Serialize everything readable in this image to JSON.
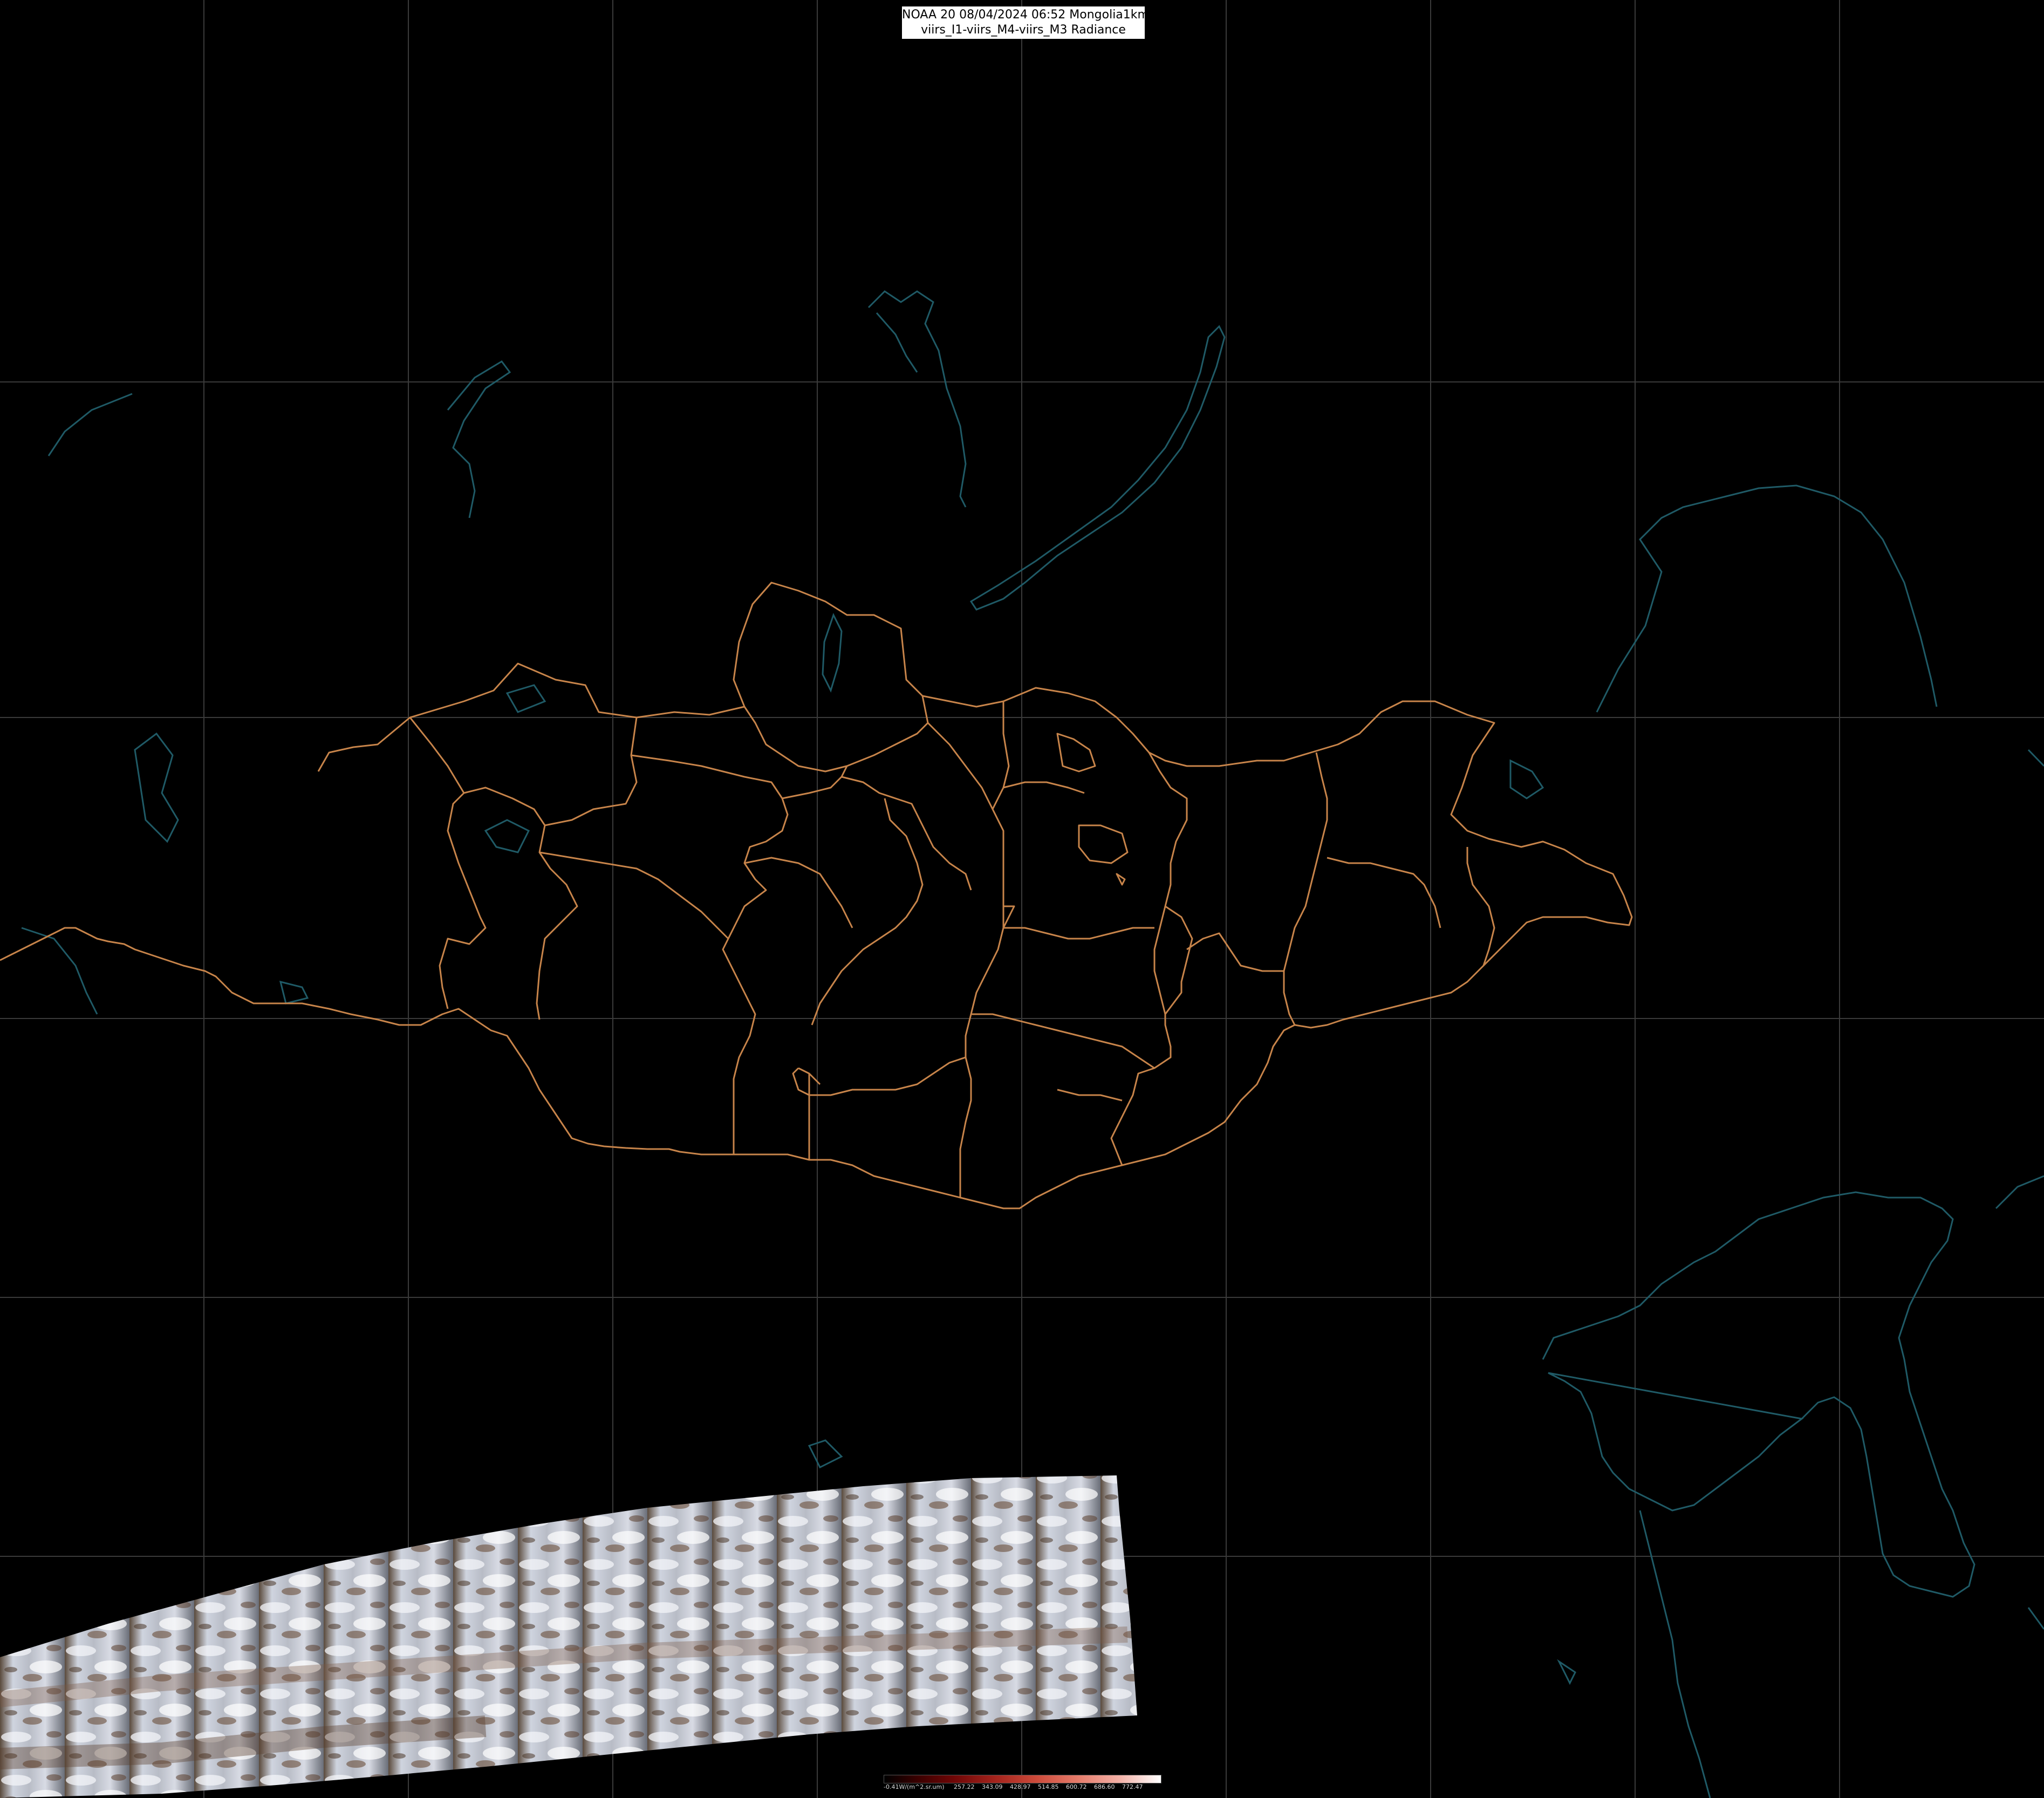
{
  "title": {
    "line1": "NOAA 20 08/04/2024 06:52 Mongolia1km",
    "line2": "viirs_I1-viirs_M4-viirs_M3 Radiance"
  },
  "colorbar": {
    "unit_label": "-0.41W/(m^2.sr.um)",
    "ticks": [
      "257.22",
      "343.09",
      "428.97",
      "514.85",
      "600.72",
      "686.60",
      "772.47"
    ]
  },
  "colors": {
    "background": "#000000",
    "graticule": "#3a3a3a",
    "admin_border": "#c7844a",
    "coastline": "#1f5a66"
  }
}
